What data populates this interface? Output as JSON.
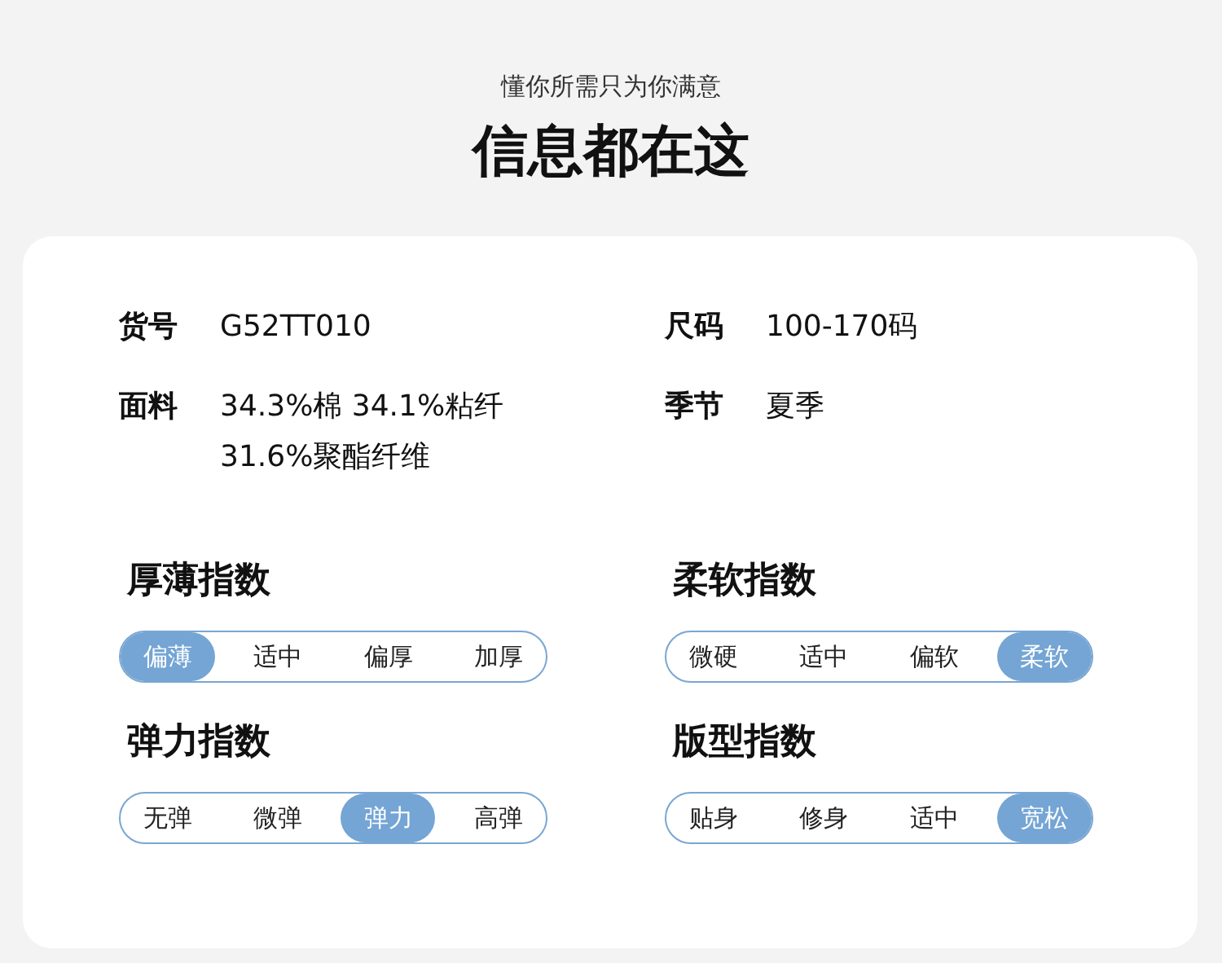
{
  "header": {
    "subtitle": "懂你所需只为你满意",
    "title": "信息都在这"
  },
  "specs": [
    {
      "label": "货号",
      "lines": [
        "G52TT010"
      ]
    },
    {
      "label": "尺码",
      "lines": [
        "100-170码"
      ]
    },
    {
      "label": "面料",
      "lines": [
        "34.3%棉 34.1%粘纤",
        "31.6%聚酯纤维"
      ]
    },
    {
      "label": "季节",
      "lines": [
        "夏季"
      ]
    }
  ],
  "indices": [
    {
      "title": "厚薄指数",
      "options": [
        {
          "label": "偏薄",
          "selected": true
        },
        {
          "label": "适中",
          "selected": false
        },
        {
          "label": "偏厚",
          "selected": false
        },
        {
          "label": "加厚",
          "selected": false
        }
      ]
    },
    {
      "title": "柔软指数",
      "options": [
        {
          "label": "微硬",
          "selected": false
        },
        {
          "label": "适中",
          "selected": false
        },
        {
          "label": "偏软",
          "selected": false
        },
        {
          "label": "柔软",
          "selected": true
        }
      ]
    },
    {
      "title": "弹力指数",
      "options": [
        {
          "label": "无弹",
          "selected": false
        },
        {
          "label": "微弹",
          "selected": false
        },
        {
          "label": "弹力",
          "selected": true
        },
        {
          "label": "高弹",
          "selected": false
        }
      ]
    },
    {
      "title": "版型指数",
      "options": [
        {
          "label": "贴身",
          "selected": false
        },
        {
          "label": "修身",
          "selected": false
        },
        {
          "label": "适中",
          "selected": false
        },
        {
          "label": "宽松",
          "selected": true
        }
      ]
    }
  ]
}
